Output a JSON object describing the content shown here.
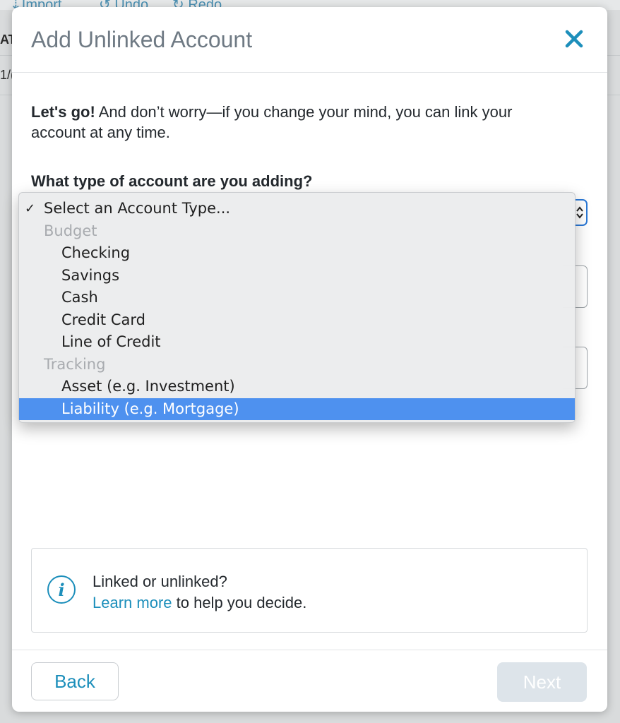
{
  "background": {
    "toolbar": {
      "import_label": "Import",
      "undo_label": "Undo",
      "redo_label": "Redo"
    },
    "row_fragment_1": "AT",
    "row_fragment_2": "1/("
  },
  "modal": {
    "title": "Add Unlinked Account",
    "close_icon": "close-icon",
    "intro_bold": "Let's go!",
    "intro_text": " And don’t worry—if you change your mind, you can link your account at any time.",
    "question": "What type of account are you adding?",
    "account_type_select": {
      "selected_value": "Select an Account Type...",
      "options": [
        {
          "label": "Select an Account Type...",
          "kind": "top",
          "checked": true
        },
        {
          "label": "Budget",
          "kind": "group"
        },
        {
          "label": "Checking",
          "kind": "option"
        },
        {
          "label": "Savings",
          "kind": "option"
        },
        {
          "label": "Cash",
          "kind": "option"
        },
        {
          "label": "Credit Card",
          "kind": "option"
        },
        {
          "label": "Line of Credit",
          "kind": "option"
        },
        {
          "label": "Tracking",
          "kind": "group"
        },
        {
          "label": "Asset (e.g. Investment)",
          "kind": "option"
        },
        {
          "label": "Liability (e.g. Mortgage)",
          "kind": "option",
          "highlighted": true
        }
      ]
    },
    "info_box": {
      "icon": "info-icon",
      "line1": "Linked or unlinked?",
      "link_text": "Learn more",
      "line2_rest": " to help you decide."
    },
    "footer": {
      "back_label": "Back",
      "next_label": "Next"
    }
  },
  "colors": {
    "accent": "#1d8fbb",
    "highlight": "#4e91ef",
    "next_disabled_bg": "#dde4ea",
    "title_gray": "#6f7a84"
  }
}
